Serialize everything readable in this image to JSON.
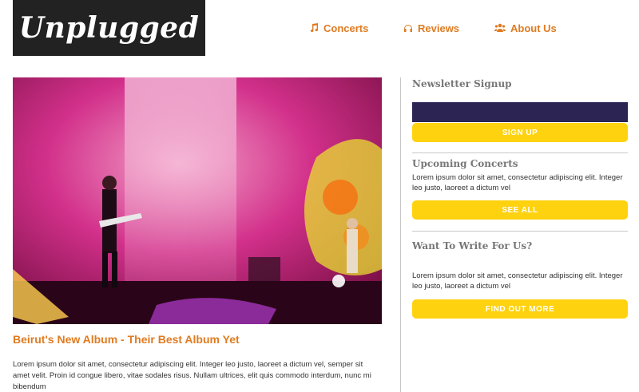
{
  "logo": {
    "text": "Unplugged"
  },
  "nav": [
    {
      "label": "Concerts",
      "icon": "music-note-icon"
    },
    {
      "label": "Reviews",
      "icon": "headphones-icon"
    },
    {
      "label": "About Us",
      "icon": "users-icon"
    }
  ],
  "colors": {
    "accent": "#e07b21",
    "button": "#ffd20f",
    "input": "#2c2554",
    "logo_bg": "#222222"
  },
  "hero": {
    "alt": "Concert photo on stage with pink lights"
  },
  "article": {
    "title": "Beirut's New Album - Their Best Album Yet",
    "body": "Lorem ipsum dolor sit amet, consectetur adipiscing elit. Integer leo justo, laoreet a dictum vel, semper sit amet velit. Proin id congue libero, vitae sodales risus. Nullam ultrices, elit quis commodo interdum, nunc mi bibendum"
  },
  "sidebar": {
    "newsletter": {
      "title": "Newsletter Signup",
      "button": "SIGN UP"
    },
    "concerts": {
      "title": "Upcoming Concerts",
      "text": "Lorem ipsum dolor sit amet, consectetur adipiscing elit. Integer leo justo, laoreet a dictum vel",
      "button": "SEE ALL"
    },
    "write": {
      "title": "Want To Write For Us?",
      "text": "Lorem ipsum dolor sit amet, consectetur adipiscing elit. Integer leo justo, laoreet a dictum vel",
      "button": "FIND OUT MORE"
    }
  }
}
